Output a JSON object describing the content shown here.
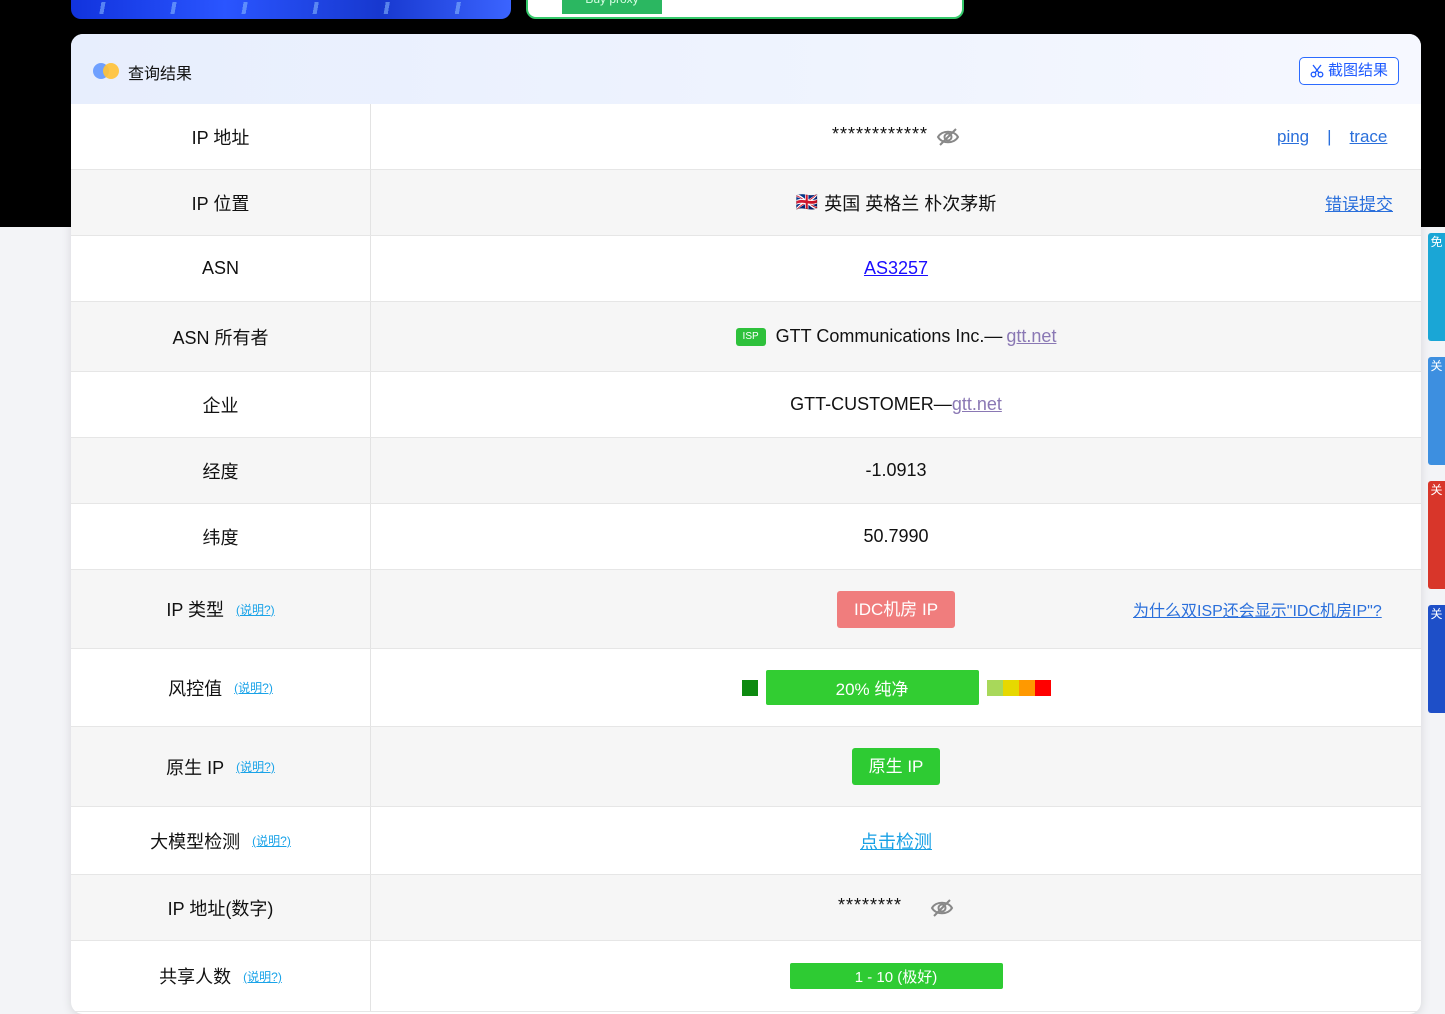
{
  "banner": {
    "right_button": "Buy proxy"
  },
  "header": {
    "title": "查询结果",
    "screenshot_button": "截图结果"
  },
  "rows": {
    "ip": {
      "label": "IP 地址",
      "value": "************",
      "ping": "ping",
      "separator": "|",
      "trace": "trace"
    },
    "location": {
      "label": "IP 位置",
      "flag": "🇬🇧",
      "value": "英国 英格兰 朴次茅斯",
      "report": "错误提交"
    },
    "asn": {
      "label": "ASN",
      "value": "AS3257"
    },
    "asn_owner": {
      "label": "ASN 所有者",
      "tag": "ISP",
      "name": "GTT Communications Inc.—",
      "domain": "gtt.net"
    },
    "enterprise": {
      "label": "企业",
      "name": "GTT-CUSTOMER—",
      "domain": "gtt.net"
    },
    "longitude": {
      "label": "经度",
      "value": "-1.0913"
    },
    "latitude": {
      "label": "纬度",
      "value": "50.7990"
    },
    "ip_type": {
      "label": "IP 类型",
      "help": "(说明?)",
      "value": "IDC机房 IP",
      "note": "为什么双ISP还会显示\"IDC机房IP\"?"
    },
    "risk": {
      "label": "风控值",
      "help": "(说明?)",
      "value": "20%  纯净",
      "percent": 20
    },
    "native": {
      "label": "原生 IP",
      "help": "(说明?)",
      "value": "原生 IP"
    },
    "llm": {
      "label": "大模型检测",
      "help": "(说明?)",
      "value": "点击检测"
    },
    "ip_numeric": {
      "label": "IP 地址(数字)",
      "value": "********"
    },
    "shared": {
      "label": "共享人数",
      "help": "(说明?)",
      "value": "1 - 10 (极好)"
    }
  },
  "side_tabs": [
    "免",
    "关",
    "关",
    "关"
  ],
  "colors": {
    "accent": "#2c6bff",
    "idc_badge": "#f07d7d",
    "green_badge": "#2ecb33",
    "risk_scale": [
      "#a8d85a",
      "#e6d800",
      "#ff9900",
      "#ff0000"
    ]
  }
}
